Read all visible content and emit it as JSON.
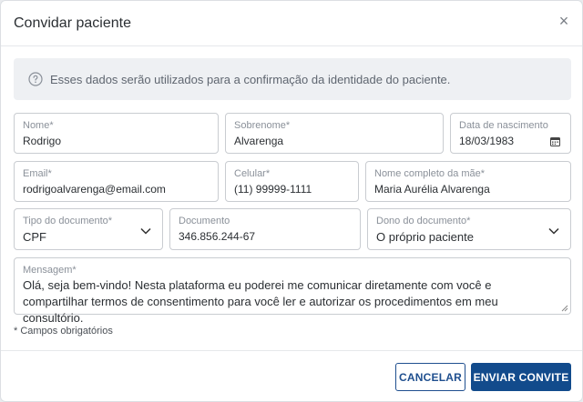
{
  "modal": {
    "title": "Convidar paciente",
    "close_glyph": "×"
  },
  "info": {
    "icon": "question-circle-icon",
    "text": "Esses dados serão utilizados para a confirmação da identidade do paciente."
  },
  "form": {
    "nome": {
      "label": "Nome*",
      "value": "Rodrigo"
    },
    "sobrenome": {
      "label": "Sobrenome*",
      "value": "Alvarenga"
    },
    "nascimento": {
      "label": "Data de nascimento",
      "value": "18/03/1983",
      "icon": "calendar-icon"
    },
    "email": {
      "label": "Email*",
      "value": "rodrigoalvarenga@email.com"
    },
    "celular": {
      "label": "Celular*",
      "value": "(11) 99999-1111"
    },
    "mae": {
      "label": "Nome completo da mãe*",
      "value": "Maria Aurélia Alvarenga"
    },
    "tipo_documento": {
      "label": "Tipo do documento*",
      "value": "CPF",
      "icon": "chevron-down-icon"
    },
    "documento": {
      "label": "Documento",
      "value": "346.856.244-67"
    },
    "dono_documento": {
      "label": "Dono do documento*",
      "value": "O próprio paciente",
      "icon": "chevron-down-icon"
    },
    "mensagem": {
      "label": "Mensagem*",
      "value": "Olá, seja bem-vindo! Nesta plataforma eu poderei me comunicar diretamente com você e compartilhar termos de consentimento para você ler e autorizar os procedimentos em meu consultório."
    },
    "required_note": "* Campos obrigatórios"
  },
  "actions": {
    "cancel_label": "CANCELAR",
    "send_label": "ENVIAR CONVITE"
  },
  "colors": {
    "primary": "#124b8c",
    "border": "#c9ccd1",
    "info_bg": "#eef0f3"
  }
}
